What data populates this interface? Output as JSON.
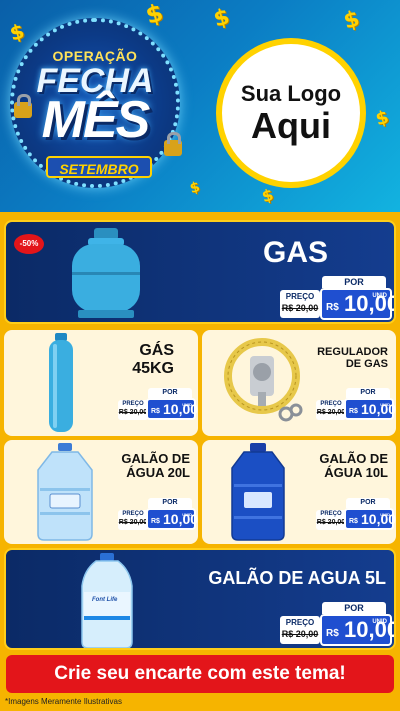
{
  "header": {
    "campaign_top": "OPERAÇÃO",
    "campaign_main1": "FECHA",
    "campaign_main2": "MÊS",
    "campaign_month": "SETEMBRO",
    "logo_line1": "Sua Logo",
    "logo_line2": "Aqui",
    "dollar_symbol": "$"
  },
  "products": {
    "gas": {
      "title": "GAS",
      "discount": "-50%",
      "old_label": "PREÇO",
      "old_price": "R$ 20,00",
      "por": "POR",
      "currency": "R$",
      "price": "10,00",
      "unit": "UNID"
    },
    "gas45": {
      "title_line1": "GÁS",
      "title_line2": "45KG",
      "old_label": "PREÇO",
      "old_price": "R$ 20,00",
      "por": "POR",
      "currency": "R$",
      "price": "10,00",
      "unit": "UNID"
    },
    "regulador": {
      "title_line1": "REGULADOR",
      "title_line2": "DE GAS",
      "old_label": "PREÇO",
      "old_price": "R$ 20,00",
      "por": "POR",
      "currency": "R$",
      "price": "10,00",
      "unit": "UNID"
    },
    "galao20": {
      "title_line1": "GALÃO DE",
      "title_line2": "ÁGUA 20L",
      "old_label": "PREÇO",
      "old_price": "R$ 20,00",
      "por": "POR",
      "currency": "R$",
      "price": "10,00",
      "unit": "UNID"
    },
    "galao10": {
      "title_line1": "GALÃO DE",
      "title_line2": "ÁGUA 10L",
      "old_label": "PREÇO",
      "old_price": "R$ 20,00",
      "por": "POR",
      "currency": "R$",
      "price": "10,00",
      "unit": "UNID"
    },
    "galao5": {
      "title": "GALÃO DE AGUA 5L",
      "old_label": "PREÇO",
      "old_price": "R$ 20,00",
      "por": "POR",
      "currency": "R$",
      "price": "10,00",
      "unit": "UNID",
      "bottle_brand": "Font Life"
    }
  },
  "cta": "Crie seu encarte com este tema!",
  "footnote": "*Imagens Meramente Ilustrativas",
  "colors": {
    "navy": "#0b2a66",
    "yellow": "#ffce1a",
    "red": "#e3151a",
    "blue": "#1f4fd0"
  }
}
